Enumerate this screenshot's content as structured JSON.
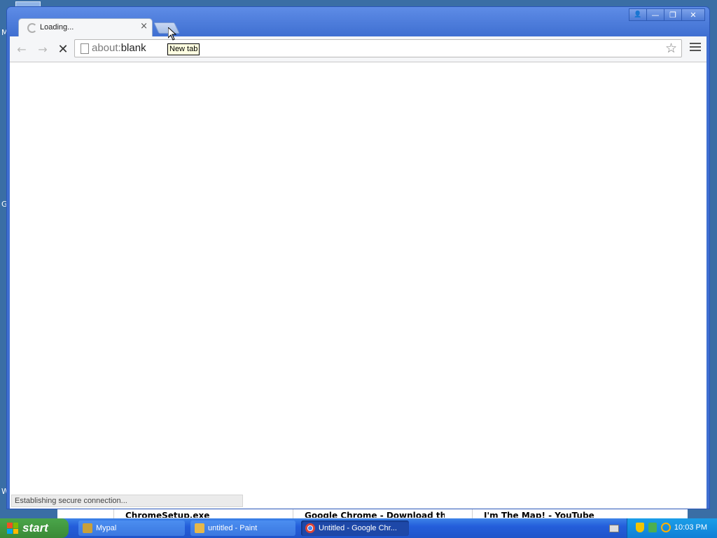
{
  "desktop": {
    "bottom_titles": [
      "ChromeSetup.exe",
      "Google Chrome - Download the",
      "I'm The Map! - YouTube"
    ],
    "side_letters": [
      "M",
      "G",
      "W"
    ]
  },
  "window": {
    "tab": {
      "title": "Loading...",
      "close": "×"
    },
    "tooltip": "New tab",
    "controls": {
      "user": "👤",
      "minimize": "—",
      "maximize": "❐",
      "close": "✕"
    },
    "omnibox": {
      "scheme": "about:",
      "rest": "blank"
    },
    "nav": {
      "back": "←",
      "forward": "→",
      "stop": "✕",
      "star": "☆"
    },
    "status": "Establishing secure connection..."
  },
  "taskbar": {
    "start_label": "start",
    "items": [
      {
        "label": "Mypal",
        "active": false
      },
      {
        "label": "untitled - Paint",
        "active": false
      },
      {
        "label": "Untitled - Google Chr...",
        "active": true
      }
    ],
    "clock": "10:03 PM"
  },
  "colors": {
    "desktop": "#3a6ea5",
    "window_frame": "#3f6fd1",
    "taskbar": "#245edb",
    "start_button": "#3a8a36",
    "tray": "#0f7fd6"
  }
}
